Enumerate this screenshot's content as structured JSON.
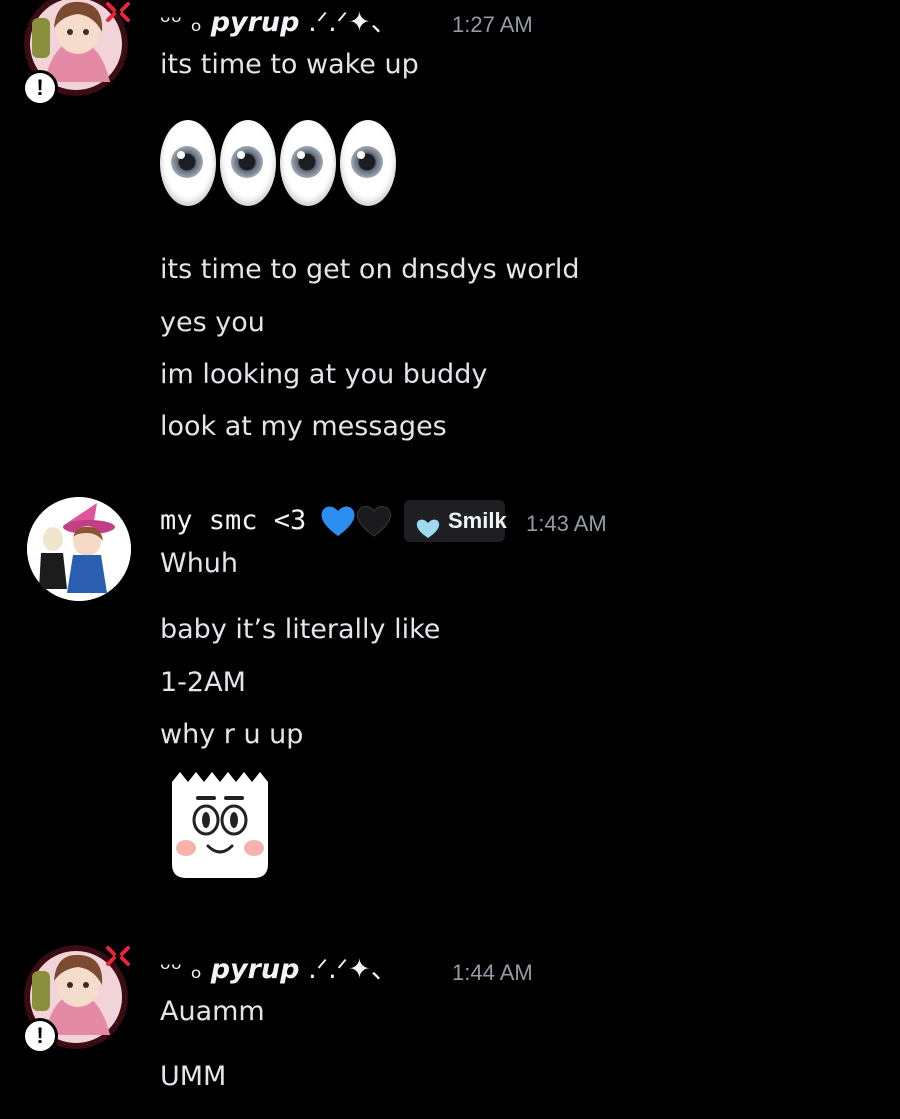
{
  "messages": [
    {
      "author": {
        "prefix": "ᵕᵕ ₒ",
        "name": "pyrup",
        "suffix": ".ᐟ.ᐟ✦、"
      },
      "timestamp": "1:27 AM",
      "status_badge": "!",
      "lines": [
        "its time to wake up",
        "its time to get on dnsdys world",
        "yes you",
        "im looking at you buddy",
        "look at my messages"
      ],
      "emoji": [
        "eyes-emoji",
        "eyes-emoji"
      ]
    },
    {
      "author": {
        "name": "my smc <3",
        "hearts": [
          "💙",
          "🖤"
        ]
      },
      "tag": {
        "label": "Smilk",
        "icon": "heart-tag-icon"
      },
      "timestamp": "1:43 AM",
      "lines": [
        "Whuh",
        "baby it’s literally like",
        "1-2AM",
        "why r u up"
      ],
      "sticker": "surprised-face-sticker"
    },
    {
      "author": {
        "prefix": "ᵕᵕ ₒ",
        "name": "pyrup",
        "suffix": ".ᐟ.ᐟ✦、"
      },
      "timestamp": "1:44 AM",
      "status_badge": "!",
      "lines": [
        "Auamm",
        "UMM"
      ]
    }
  ],
  "colors": {
    "background": "#000000",
    "text": "#e3e5e8",
    "timestamp": "#949ba4",
    "tag_bg": "#1e1f22"
  }
}
